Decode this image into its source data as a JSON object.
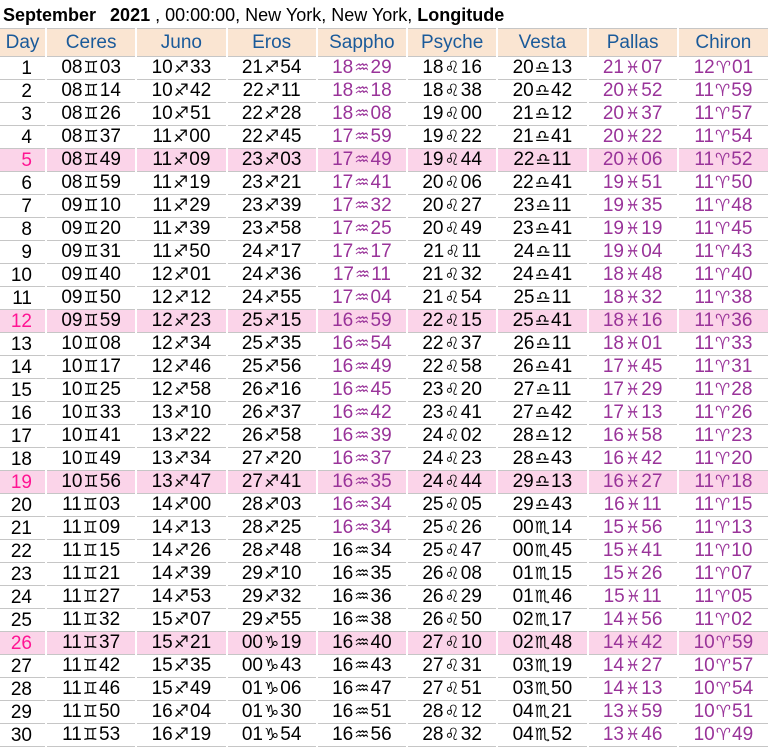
{
  "title": {
    "month": "September",
    "year": "2021",
    "middle": ", 00:00:00, New York, New York,",
    "suffix": "Longitude"
  },
  "colors": {
    "header_bg": "#fae5d2",
    "header_text": "#1a5a9a",
    "retrograde_text": "#993399",
    "highlight_row_bg": "#fbd4e9",
    "highlight_day_text": "#ff1493",
    "grid_line": "#c6c6c6",
    "body_text": "#000000"
  },
  "table": {
    "columns": [
      "Day",
      "Ceres",
      "Juno",
      "Eros",
      "Sappho",
      "Psyche",
      "Vesta",
      "Pallas",
      "Chiron"
    ],
    "highlighted_days": [
      5,
      12,
      19,
      26
    ],
    "retrograde_note": "purple cells indicate retrograde motion",
    "rows": [
      {
        "day": "1",
        "cells": [
          "08♊03",
          "10♐33",
          "21♐54",
          "18♒29",
          "18♌16",
          "20♎13",
          "21♓07",
          "12♈01"
        ],
        "purple_cols": [
          3,
          6,
          7
        ]
      },
      {
        "day": "2",
        "cells": [
          "08♊14",
          "10♐42",
          "22♐11",
          "18♒18",
          "18♌38",
          "20♎42",
          "20♓52",
          "11♈59"
        ],
        "purple_cols": [
          3,
          6,
          7
        ]
      },
      {
        "day": "3",
        "cells": [
          "08♊26",
          "10♐51",
          "22♐28",
          "18♒08",
          "19♌00",
          "21♎12",
          "20♓37",
          "11♈57"
        ],
        "purple_cols": [
          3,
          6,
          7
        ]
      },
      {
        "day": "4",
        "cells": [
          "08♊37",
          "11♐00",
          "22♐45",
          "17♒59",
          "19♌22",
          "21♎41",
          "20♓22",
          "11♈54"
        ],
        "purple_cols": [
          3,
          6,
          7
        ]
      },
      {
        "day": "5",
        "cells": [
          "08♊49",
          "11♐09",
          "23♐03",
          "17♒49",
          "19♌44",
          "22♎11",
          "20♓06",
          "11♈52"
        ],
        "purple_cols": [
          3,
          6,
          7
        ]
      },
      {
        "day": "6",
        "cells": [
          "08♊59",
          "11♐19",
          "23♐21",
          "17♒41",
          "20♌06",
          "22♎41",
          "19♓51",
          "11♈50"
        ],
        "purple_cols": [
          3,
          6,
          7
        ]
      },
      {
        "day": "7",
        "cells": [
          "09♊10",
          "11♐29",
          "23♐39",
          "17♒32",
          "20♌27",
          "23♎11",
          "19♓35",
          "11♈48"
        ],
        "purple_cols": [
          3,
          6,
          7
        ]
      },
      {
        "day": "8",
        "cells": [
          "09♊20",
          "11♐39",
          "23♐58",
          "17♒25",
          "20♌49",
          "23♎41",
          "19♓19",
          "11♈45"
        ],
        "purple_cols": [
          3,
          6,
          7
        ]
      },
      {
        "day": "9",
        "cells": [
          "09♊31",
          "11♐50",
          "24♐17",
          "17♒17",
          "21♌11",
          "24♎11",
          "19♓04",
          "11♈43"
        ],
        "purple_cols": [
          3,
          6,
          7
        ]
      },
      {
        "day": "10",
        "cells": [
          "09♊40",
          "12♐01",
          "24♐36",
          "17♒11",
          "21♌32",
          "24♎41",
          "18♓48",
          "11♈40"
        ],
        "purple_cols": [
          3,
          6,
          7
        ]
      },
      {
        "day": "11",
        "cells": [
          "09♊50",
          "12♐12",
          "24♐55",
          "17♒04",
          "21♌54",
          "25♎11",
          "18♓32",
          "11♈38"
        ],
        "purple_cols": [
          3,
          6,
          7
        ]
      },
      {
        "day": "12",
        "cells": [
          "09♊59",
          "12♐23",
          "25♐15",
          "16♒59",
          "22♌15",
          "25♎41",
          "18♓16",
          "11♈36"
        ],
        "purple_cols": [
          3,
          6,
          7
        ]
      },
      {
        "day": "13",
        "cells": [
          "10♊08",
          "12♐34",
          "25♐35",
          "16♒54",
          "22♌37",
          "26♎11",
          "18♓01",
          "11♈33"
        ],
        "purple_cols": [
          3,
          6,
          7
        ]
      },
      {
        "day": "14",
        "cells": [
          "10♊17",
          "12♐46",
          "25♐56",
          "16♒49",
          "22♌58",
          "26♎41",
          "17♓45",
          "11♈31"
        ],
        "purple_cols": [
          3,
          6,
          7
        ]
      },
      {
        "day": "15",
        "cells": [
          "10♊25",
          "12♐58",
          "26♐16",
          "16♒45",
          "23♌20",
          "27♎11",
          "17♓29",
          "11♈28"
        ],
        "purple_cols": [
          3,
          6,
          7
        ]
      },
      {
        "day": "16",
        "cells": [
          "10♊33",
          "13♐10",
          "26♐37",
          "16♒42",
          "23♌41",
          "27♎42",
          "17♓13",
          "11♈26"
        ],
        "purple_cols": [
          3,
          6,
          7
        ]
      },
      {
        "day": "17",
        "cells": [
          "10♊41",
          "13♐22",
          "26♐58",
          "16♒39",
          "24♌02",
          "28♎12",
          "16♓58",
          "11♈23"
        ],
        "purple_cols": [
          3,
          6,
          7
        ]
      },
      {
        "day": "18",
        "cells": [
          "10♊49",
          "13♐34",
          "27♐20",
          "16♒37",
          "24♌23",
          "28♎43",
          "16♓42",
          "11♈20"
        ],
        "purple_cols": [
          3,
          6,
          7
        ]
      },
      {
        "day": "19",
        "cells": [
          "10♊56",
          "13♐47",
          "27♐41",
          "16♒35",
          "24♌44",
          "29♎13",
          "16♓27",
          "11♈18"
        ],
        "purple_cols": [
          3,
          6,
          7
        ]
      },
      {
        "day": "20",
        "cells": [
          "11♊03",
          "14♐00",
          "28♐03",
          "16♒34",
          "25♌05",
          "29♎43",
          "16♓11",
          "11♈15"
        ],
        "purple_cols": [
          3,
          6,
          7
        ]
      },
      {
        "day": "21",
        "cells": [
          "11♊09",
          "14♐13",
          "28♐25",
          "16♒34",
          "25♌26",
          "00♏14",
          "15♓56",
          "11♈13"
        ],
        "purple_cols": [
          3,
          6,
          7
        ]
      },
      {
        "day": "22",
        "cells": [
          "11♊15",
          "14♐26",
          "28♐48",
          "16♒34",
          "25♌47",
          "00♏45",
          "15♓41",
          "11♈10"
        ],
        "purple_cols": [
          6,
          7
        ]
      },
      {
        "day": "23",
        "cells": [
          "11♊21",
          "14♐39",
          "29♐10",
          "16♒35",
          "26♌08",
          "01♏15",
          "15♓26",
          "11♈07"
        ],
        "purple_cols": [
          6,
          7
        ]
      },
      {
        "day": "24",
        "cells": [
          "11♊27",
          "14♐53",
          "29♐32",
          "16♒36",
          "26♌29",
          "01♏46",
          "15♓11",
          "11♈05"
        ],
        "purple_cols": [
          6,
          7
        ]
      },
      {
        "day": "25",
        "cells": [
          "11♊32",
          "15♐07",
          "29♐55",
          "16♒38",
          "26♌50",
          "02♏17",
          "14♓56",
          "11♈02"
        ],
        "purple_cols": [
          6,
          7
        ]
      },
      {
        "day": "26",
        "cells": [
          "11♊37",
          "15♐21",
          "00♑19",
          "16♒40",
          "27♌10",
          "02♏48",
          "14♓42",
          "10♈59"
        ],
        "purple_cols": [
          6,
          7
        ]
      },
      {
        "day": "27",
        "cells": [
          "11♊42",
          "15♐35",
          "00♑43",
          "16♒43",
          "27♌31",
          "03♏19",
          "14♓27",
          "10♈57"
        ],
        "purple_cols": [
          6,
          7
        ]
      },
      {
        "day": "28",
        "cells": [
          "11♊46",
          "15♐49",
          "01♑06",
          "16♒47",
          "27♌51",
          "03♏50",
          "14♓13",
          "10♈54"
        ],
        "purple_cols": [
          6,
          7
        ]
      },
      {
        "day": "29",
        "cells": [
          "11♊50",
          "16♐04",
          "01♑30",
          "16♒51",
          "28♌12",
          "04♏21",
          "13♓59",
          "10♈51"
        ],
        "purple_cols": [
          6,
          7
        ]
      },
      {
        "day": "30",
        "cells": [
          "11♊53",
          "16♐19",
          "01♑54",
          "16♒56",
          "28♌32",
          "04♏52",
          "13♓46",
          "10♈49"
        ],
        "purple_cols": [
          6,
          7
        ]
      }
    ]
  }
}
